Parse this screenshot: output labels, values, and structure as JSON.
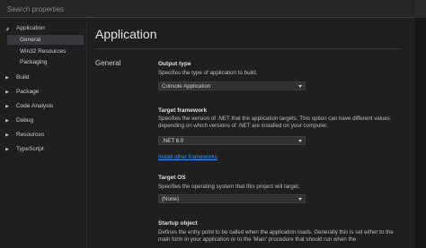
{
  "search": {
    "placeholder": "Search properties"
  },
  "sidebar": {
    "items": [
      {
        "label": "Application",
        "expanded": true,
        "arrow": "▲"
      },
      {
        "label": "Build",
        "expanded": false,
        "arrow": "▶"
      },
      {
        "label": "Package",
        "expanded": false,
        "arrow": "▶"
      },
      {
        "label": "Code Analysis",
        "expanded": false,
        "arrow": "▶"
      },
      {
        "label": "Debug",
        "expanded": false,
        "arrow": "▶"
      },
      {
        "label": "Resources",
        "expanded": false,
        "arrow": "▶"
      },
      {
        "label": "TypeScript",
        "expanded": false,
        "arrow": "▶"
      }
    ],
    "application_children": [
      {
        "label": "General",
        "selected": true
      },
      {
        "label": "Win32 Resources",
        "selected": false
      },
      {
        "label": "Packaging",
        "selected": false
      }
    ]
  },
  "main": {
    "title": "Application",
    "section": "General",
    "properties": {
      "output_type": {
        "title": "Output type",
        "description": "Specifies the type of application to build.",
        "value": "Console Application"
      },
      "target_framework": {
        "title": "Target framework",
        "description": "Specifies the version of .NET that the application targets. This option can have different values depending on which versions of .NET are installed on your computer.",
        "value": ".NET 6.0",
        "link": "Install other frameworks"
      },
      "target_os": {
        "title": "Target OS",
        "description": "Specifies the operating system that this project will target.",
        "value": "(None)"
      },
      "startup_object": {
        "title": "Startup object",
        "description": "Defines the entry point to be called when the application loads. Generally this is set either to the main form in your application or to the 'Main' procedure that should run when the"
      }
    }
  },
  "colors": {
    "background": "#1f1f1f",
    "selected": "#37373d",
    "link": "#3794ff",
    "dropdown_bg": "#313131"
  }
}
